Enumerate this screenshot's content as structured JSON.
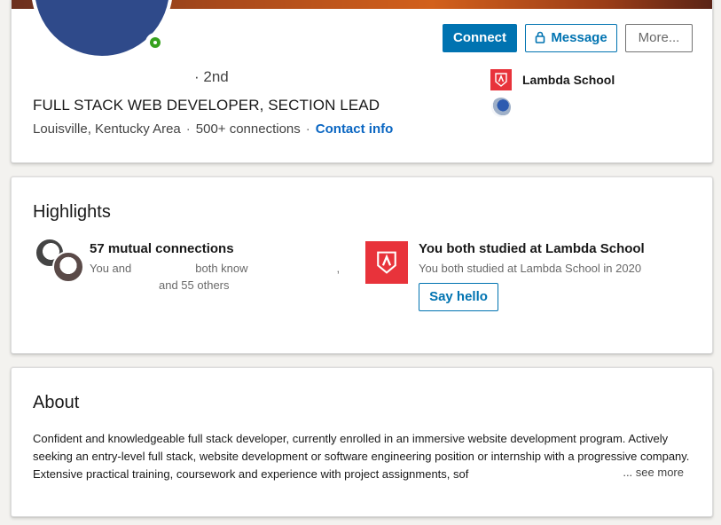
{
  "profile": {
    "degree": "· 2nd",
    "headline": "FULL STACK WEB DEVELOPER, SECTION LEAD",
    "location": "Louisville, Kentucky Area",
    "connections": "500+ connections",
    "contact_info": "Contact info",
    "online_status": "online",
    "actions": {
      "connect": "Connect",
      "message": "Message",
      "more": "More..."
    },
    "education": {
      "school": "Lambda School"
    }
  },
  "highlights": {
    "title": "Highlights",
    "mutual": {
      "title": "57 mutual connections",
      "line1_prefix": "You and",
      "line1_suffix": "both know",
      "line1_comma": ",",
      "line2_suffix": "and 55 others"
    },
    "school": {
      "title": "You both studied at Lambda School",
      "subtitle": "You both studied at Lambda School in 2020",
      "say_hello": "Say hello"
    }
  },
  "about": {
    "title": "About",
    "text": "Confident and knowledgeable full stack developer, currently enrolled in an immersive website development program. Actively seeking an entry-level full stack, website development or software engineering position or internship with a progressive company. Extensive practical training, coursework and experience with project assignments, sof",
    "ellipsis": "...",
    "see_more": "see more"
  },
  "colors": {
    "primary": "#0073b1",
    "lambda_red": "#e8333b",
    "online_green": "#36a11e"
  },
  "icons": {
    "lock": "lock-icon",
    "school": "lambda-logo-icon"
  }
}
